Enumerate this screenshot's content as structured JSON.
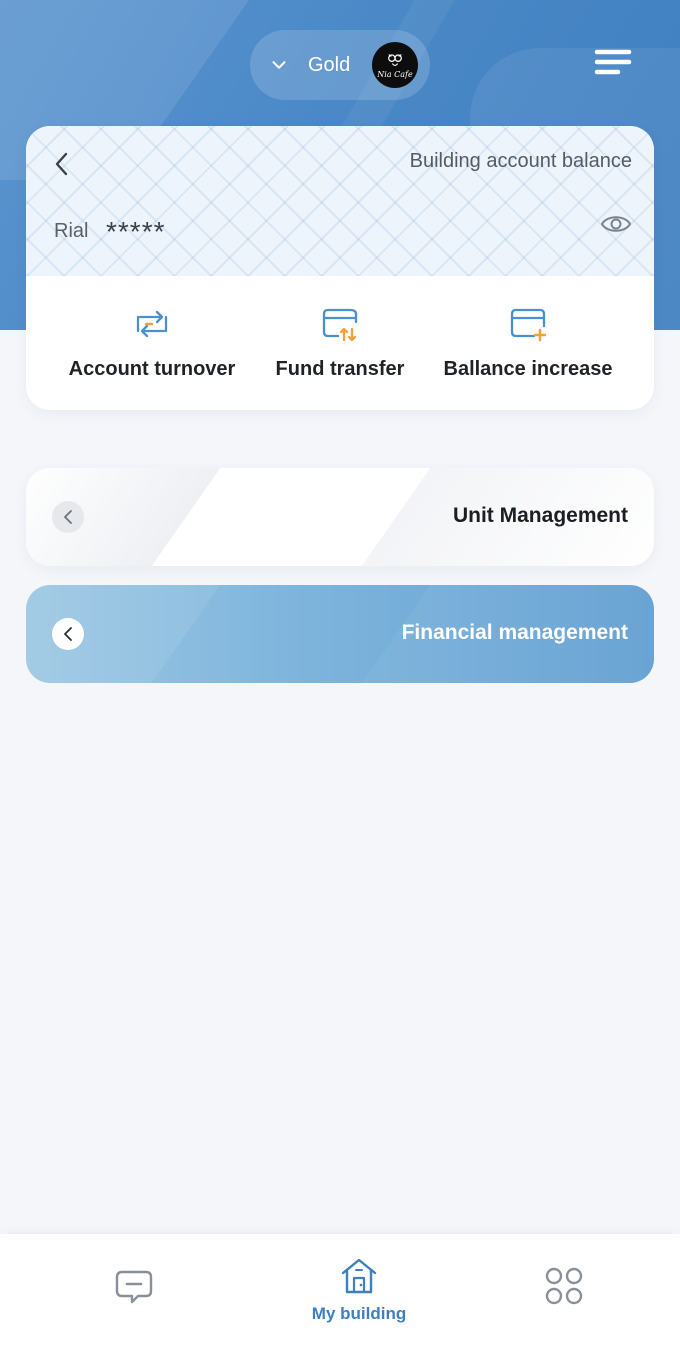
{
  "header": {
    "account_name": "Gold",
    "avatar_brand": "Nia Cafe",
    "icons": {
      "dropdown": "chevron-down-icon",
      "menu": "menu-icon"
    }
  },
  "balance_card": {
    "title": "Building account balance",
    "currency": "Rial",
    "masked_amount": "*****",
    "icons": {
      "back": "chevron-left-icon",
      "visibility": "eye-icon"
    }
  },
  "actions": [
    {
      "label": "Account turnover",
      "icon": "swap-arrows-icon"
    },
    {
      "label": "Fund transfer",
      "icon": "card-transfer-icon"
    },
    {
      "label": "Ballance increase",
      "icon": "card-add-icon"
    }
  ],
  "panels": [
    {
      "title": "Unit Management",
      "active": false
    },
    {
      "title": "Financial management",
      "active": true
    }
  ],
  "bottom_nav": {
    "items": [
      {
        "label": "",
        "icon": "message-icon"
      },
      {
        "label": "My building",
        "icon": "building-icon",
        "active": true
      },
      {
        "label": "",
        "icon": "apps-grid-icon"
      }
    ]
  },
  "colors": {
    "brand_blue": "#3f7fc0",
    "accent_orange": "#f5a03a",
    "icon_blue": "#4a90cf",
    "page_bg": "#f4f6fa"
  }
}
